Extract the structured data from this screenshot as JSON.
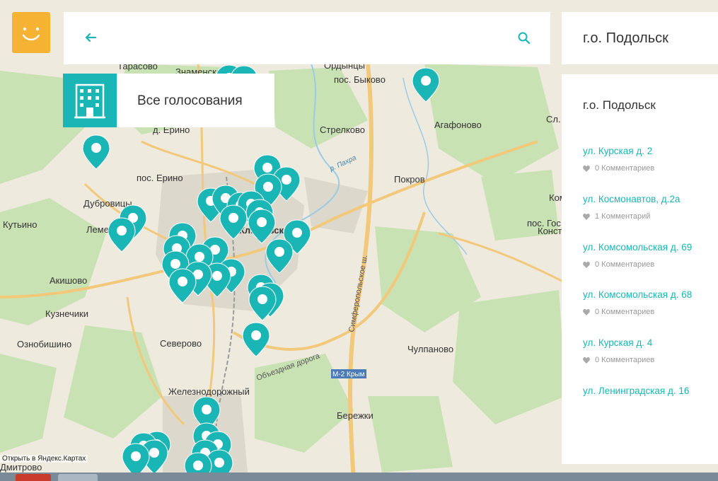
{
  "header": {
    "search_placeholder": "",
    "region": "г.о. Подольск"
  },
  "all_votes": {
    "label": "Все голосования"
  },
  "panel": {
    "title": "г.о. Подольск",
    "items": [
      {
        "address": "ул. Курская д. 2",
        "comments": "0 Комментариев"
      },
      {
        "address": "ул. Космонавтов, д.2а",
        "comments": "1 Комментарий"
      },
      {
        "address": "ул. Комсомольская д. 69",
        "comments": "0 Комментариев"
      },
      {
        "address": "ул. Комсомольская д. 68",
        "comments": "0 Комментариев"
      },
      {
        "address": "ул. Курская д. 4",
        "comments": "0 Комментариев"
      },
      {
        "address": "ул. Ленинградская д. 16",
        "comments": ""
      }
    ]
  },
  "map": {
    "places": [
      "Тарасово",
      "Знаменское",
      "Ордынцы",
      "пос. Быково",
      "Агафоново",
      "д. Ерино",
      "Стрелково",
      "р. Пахра",
      "пос. Ерино",
      "Покров",
      "Сл. Д",
      "Дубровицы",
      "Коммунарка",
      "Кутьино",
      "Лемешово",
      "Климовск",
      "пос. Гос",
      "Конст",
      "Акишово",
      "Кузнечики",
      "Ознобишино",
      "Северово",
      "Объездная дорога",
      "Симферопольское ш.",
      "Чулпаново",
      "М-2 Крым",
      "Железнодорожный",
      "Бережки",
      "Дмитрово"
    ],
    "attribution": "Открыть в Яндекс.Картах"
  },
  "colors": {
    "accent": "#1ab6b6",
    "logo": "#f6b233"
  }
}
